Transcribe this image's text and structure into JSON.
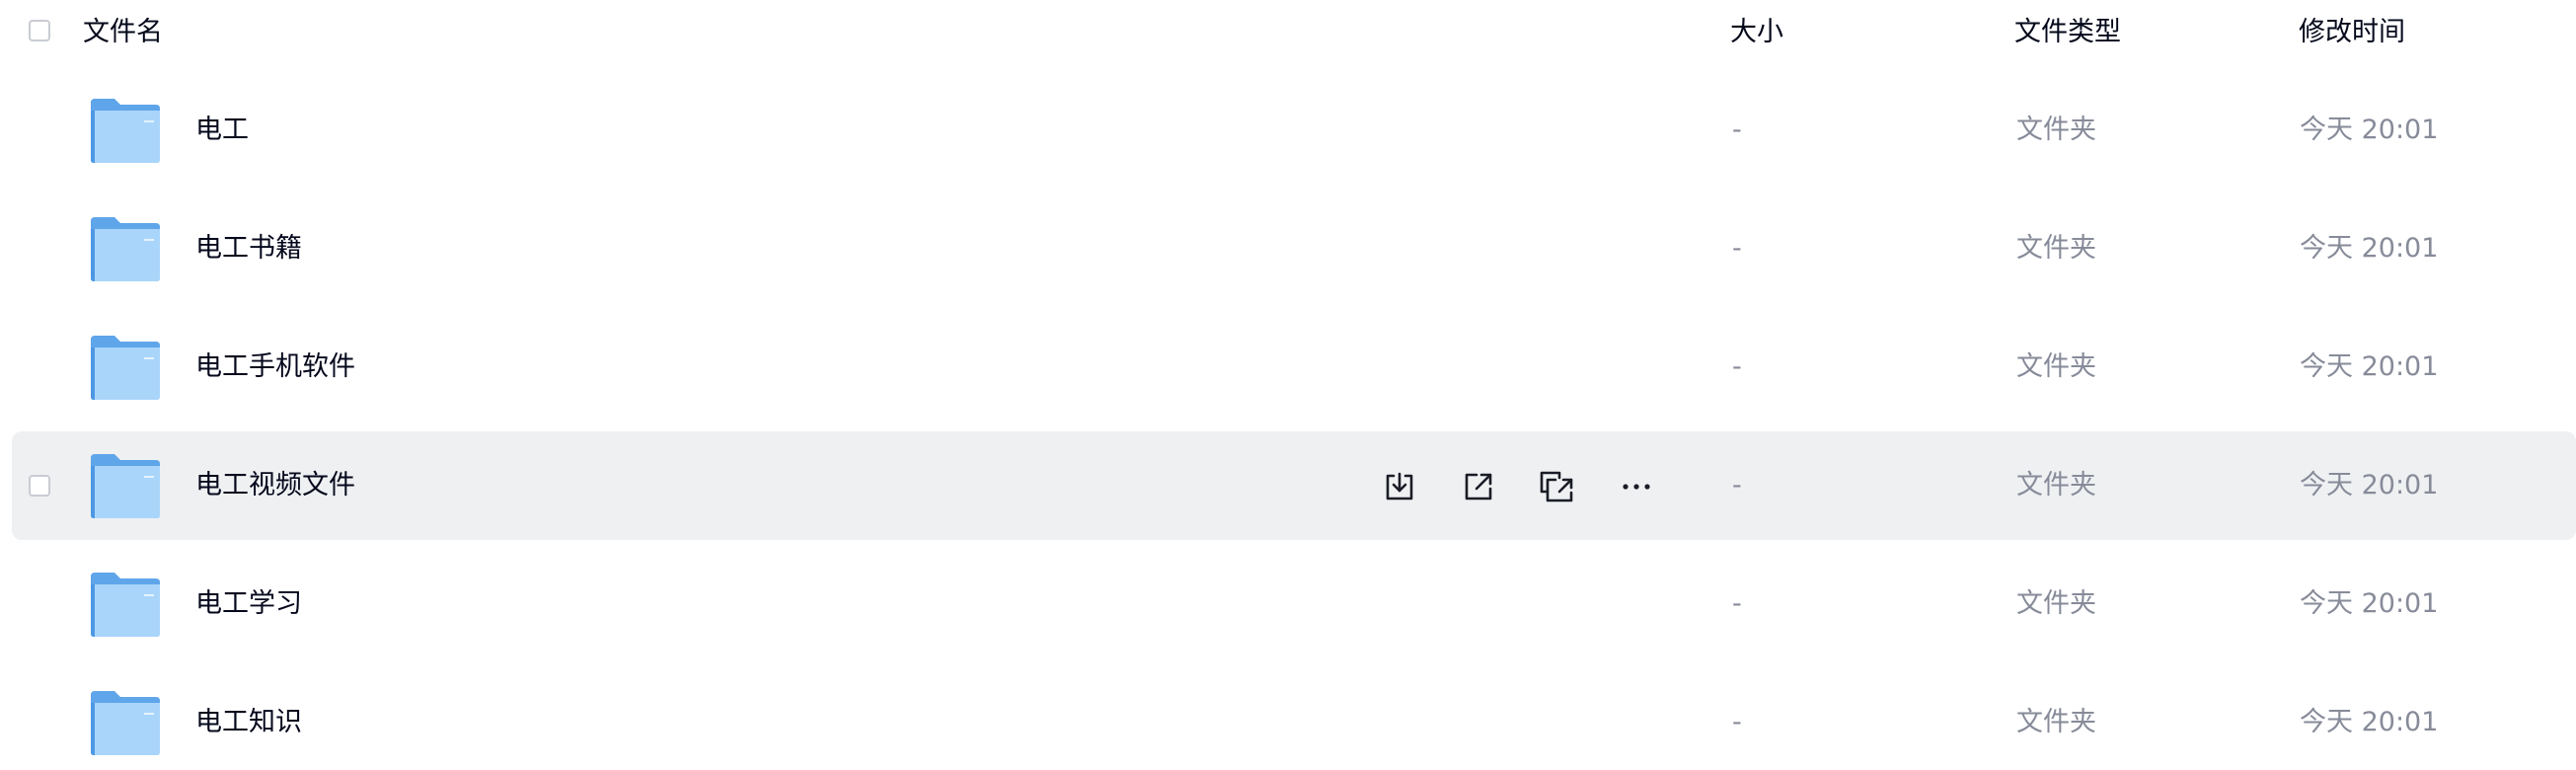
{
  "header": {
    "col_name": "文件名",
    "col_size": "大小",
    "col_type": "文件类型",
    "col_mtime": "修改时间"
  },
  "rows": [
    {
      "name": "电工",
      "size": "-",
      "type": "文件夹",
      "mtime": "今天 20:01"
    },
    {
      "name": "电工书籍",
      "size": "-",
      "type": "文件夹",
      "mtime": "今天 20:01"
    },
    {
      "name": "电工手机软件",
      "size": "-",
      "type": "文件夹",
      "mtime": "今天 20:01"
    },
    {
      "name": "电工视频文件",
      "size": "-",
      "type": "文件夹",
      "mtime": "今天 20:01"
    },
    {
      "name": "电工学习",
      "size": "-",
      "type": "文件夹",
      "mtime": "今天 20:01"
    },
    {
      "name": "电工知识",
      "size": "-",
      "type": "文件夹",
      "mtime": "今天 20:01"
    }
  ],
  "hover_row_index": 3,
  "row_actions": [
    "download-icon",
    "share-icon",
    "copy-link-icon",
    "more-icon"
  ],
  "colors": {
    "hover_bg": "#eff0f2",
    "folder_blue": "#6fb4ee",
    "text_primary": "#05081c",
    "text_secondary": "#878b99"
  }
}
